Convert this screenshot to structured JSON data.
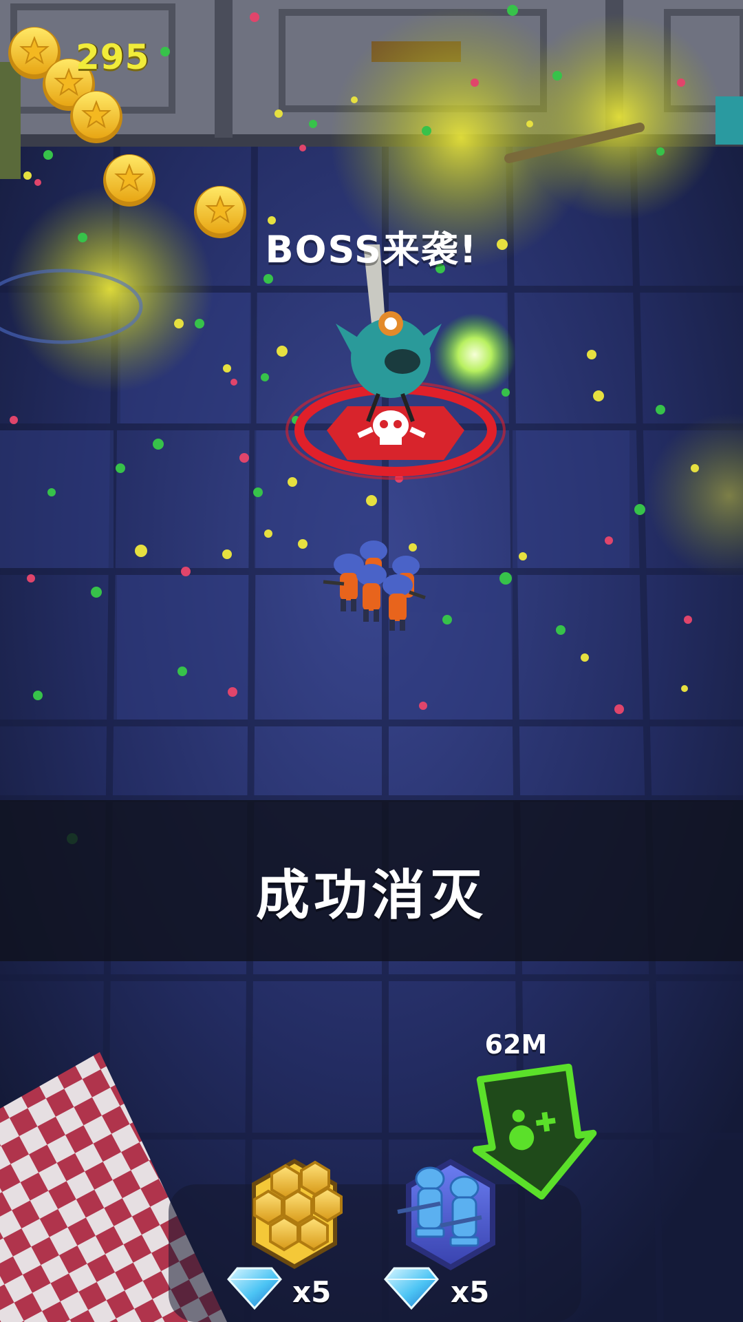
{
  "hud": {
    "coins": "295"
  },
  "alert": {
    "boss_text": "BOSS来袭!"
  },
  "banner": {
    "text": "成功消灭"
  },
  "distance": {
    "label": "62M"
  },
  "shop": {
    "items": [
      {
        "name": "honeycomb-upgrade",
        "price": "x5",
        "currency": "diamond"
      },
      {
        "name": "add-soldiers-upgrade",
        "price": "x5",
        "currency": "diamond"
      }
    ]
  },
  "colors": {
    "coin_text": "#f1ec3a",
    "boss_ring": "#e0202a",
    "arrow_green": "#5be02a",
    "floor": "#25306a"
  },
  "icons": [
    "coin-icon",
    "diamond-icon",
    "honeycomb-icon",
    "soldier-icon",
    "skull-icon",
    "arrow-down-icon"
  ]
}
